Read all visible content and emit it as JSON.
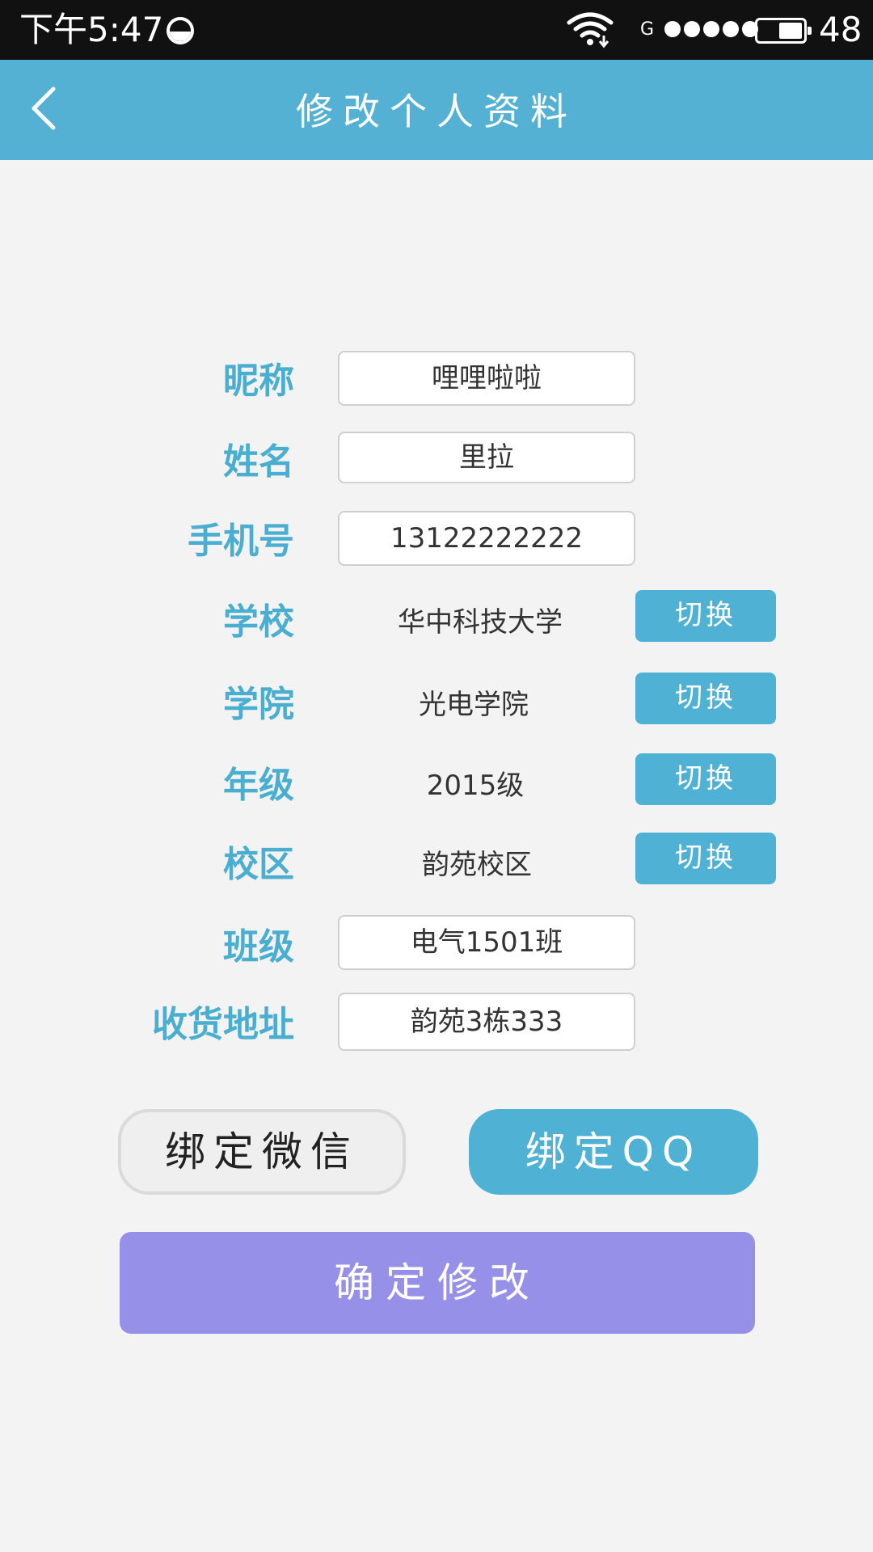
{
  "status_bar": {
    "time": "下午5:47",
    "network": "G",
    "battery_level": "48",
    "signal_dots": 5
  },
  "header": {
    "title": "修改个人资料",
    "back_icon": "chevron-left-icon"
  },
  "form": {
    "nickname": {
      "label": "昵称",
      "value": "哩哩啦啦"
    },
    "name": {
      "label": "姓名",
      "value": "里拉"
    },
    "phone": {
      "label": "手机号",
      "value": "13122222222"
    },
    "school": {
      "label": "学校",
      "value": "华中科技大学",
      "button": "切换"
    },
    "college": {
      "label": "学院",
      "value": "光电学院",
      "button": "切换"
    },
    "grade": {
      "label": "年级",
      "value": "2015级",
      "button": "切换"
    },
    "campus": {
      "label": "校区",
      "value": "韵苑校区",
      "button": "切换"
    },
    "class": {
      "label": "班级",
      "value": "电气1501班"
    },
    "address": {
      "label": "收货地址",
      "value": "韵苑3栋333"
    }
  },
  "actions": {
    "bind_wechat": "绑定微信",
    "bind_qq": "绑定QQ",
    "confirm": "确定修改"
  },
  "colors": {
    "header": "#54b1d3",
    "label": "#4aaed0",
    "switch_button": "#4fb1d4",
    "confirm_button": "#9790e8",
    "background": "#f3f3f3"
  }
}
